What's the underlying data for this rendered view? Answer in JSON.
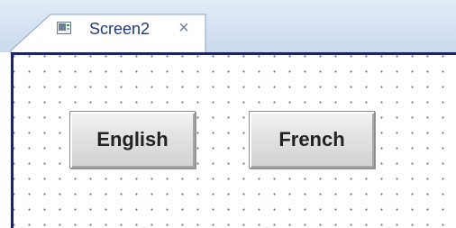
{
  "tab": {
    "title": "Screen2",
    "close_glyph": "×",
    "icon": "screen-icon"
  },
  "buttons": {
    "english_label": "English",
    "french_label": "French"
  },
  "colors": {
    "canvas_border": "#1d2563",
    "tab_title": "#1e3b78",
    "grid_dot": "#6a6f86"
  }
}
